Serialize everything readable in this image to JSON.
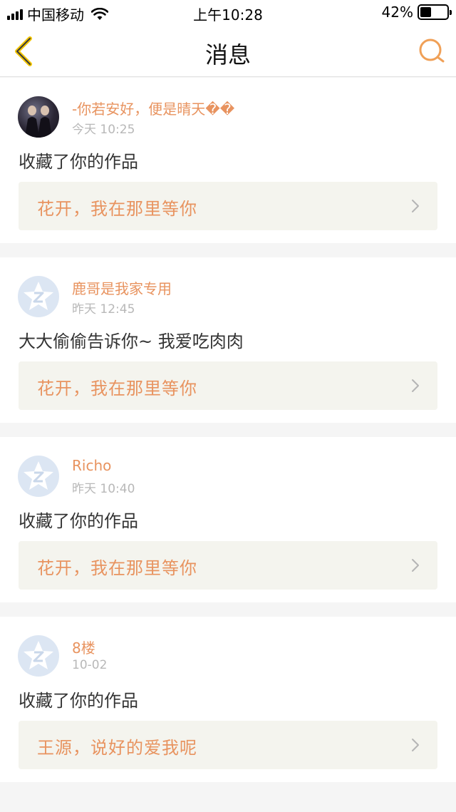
{
  "status_bar": {
    "carrier": "中国移动",
    "time": "上午10:28",
    "battery": "42%",
    "battery_level": 0.42
  },
  "nav": {
    "title": "消息"
  },
  "colors": {
    "accent": "#e8935f",
    "time_text": "#b8b8b8",
    "card_bg": "#f4f4ee"
  },
  "messages": [
    {
      "name": "-你若安好，便是晴天��",
      "time": "今天 10:25",
      "content": "收藏了你的作品",
      "work": "花开，我在那里等你",
      "avatar": "user-photo"
    },
    {
      "name": "鹿哥是我家专用",
      "time": "昨天 12:45",
      "content": "大大偷偷告诉你~ 我爱吃肉肉",
      "work": "花开，我在那里等你",
      "avatar": "default-avatar-icon"
    },
    {
      "name": "Richo",
      "time": "昨天 10:40",
      "content": "收藏了你的作品",
      "work": "花开，我在那里等你",
      "avatar": "default-avatar-icon"
    },
    {
      "name": "8楼",
      "time": "10-02",
      "content": "收藏了你的作品",
      "work": "王源，说好的爱我呢",
      "avatar": "default-avatar-icon"
    }
  ]
}
